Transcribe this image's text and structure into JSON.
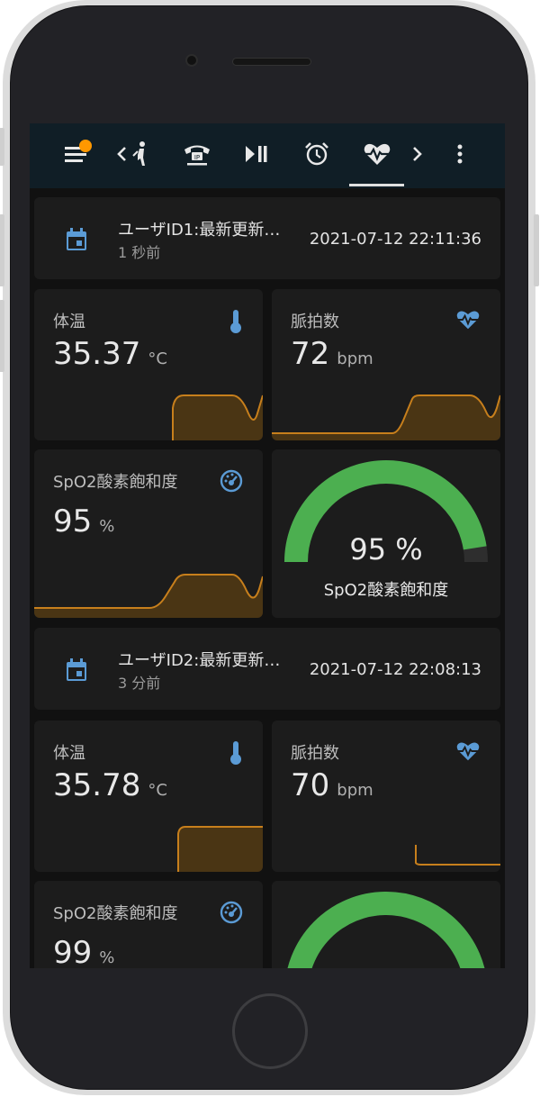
{
  "colors": {
    "accent": "#448aff",
    "icon_blue": "#5b9bd5",
    "sparkline": "#c77f1c",
    "gauge": "#4caf50",
    "badge": "#ff9800",
    "appbar": "#101e26"
  },
  "appbar": {
    "icons": [
      "menu-icon",
      "chevron-left-icon",
      "person-walking-icon",
      "ip-phone-icon",
      "play-pause-icon",
      "alarm-icon",
      "heart-pulse-icon",
      "chevron-right-icon",
      "more-vert-icon"
    ],
    "active_tab": "heart-pulse-icon"
  },
  "users": [
    {
      "title": "ユーザID1:最新更新…",
      "updated": "1 秒前",
      "datetime": "2021-07-12 22:11:36",
      "temperature": {
        "label": "体温",
        "value": "35.37",
        "unit": "°C",
        "icon": "thermometer-icon"
      },
      "pulse": {
        "label": "脈拍数",
        "value": "72",
        "unit": "bpm",
        "icon": "heart-pulse-icon"
      },
      "spo2": {
        "label": "SpO2酸素飽和度",
        "value": "95",
        "unit": "%",
        "icon": "gauge-icon"
      },
      "gauge": {
        "value_text": "95 %",
        "label": "SpO2酸素飽和度",
        "fraction": 0.95
      }
    },
    {
      "title": "ユーザID2:最新更新…",
      "updated": "3 分前",
      "datetime": "2021-07-12 22:08:13",
      "temperature": {
        "label": "体温",
        "value": "35.78",
        "unit": "°C",
        "icon": "thermometer-icon"
      },
      "pulse": {
        "label": "脈拍数",
        "value": "70",
        "unit": "bpm",
        "icon": "heart-pulse-icon"
      },
      "spo2": {
        "label": "SpO2酸素飽和度",
        "value": "99",
        "unit": "%",
        "icon": "gauge-icon"
      },
      "gauge": {
        "value_text": "",
        "label": "",
        "fraction": 0.99
      }
    }
  ]
}
